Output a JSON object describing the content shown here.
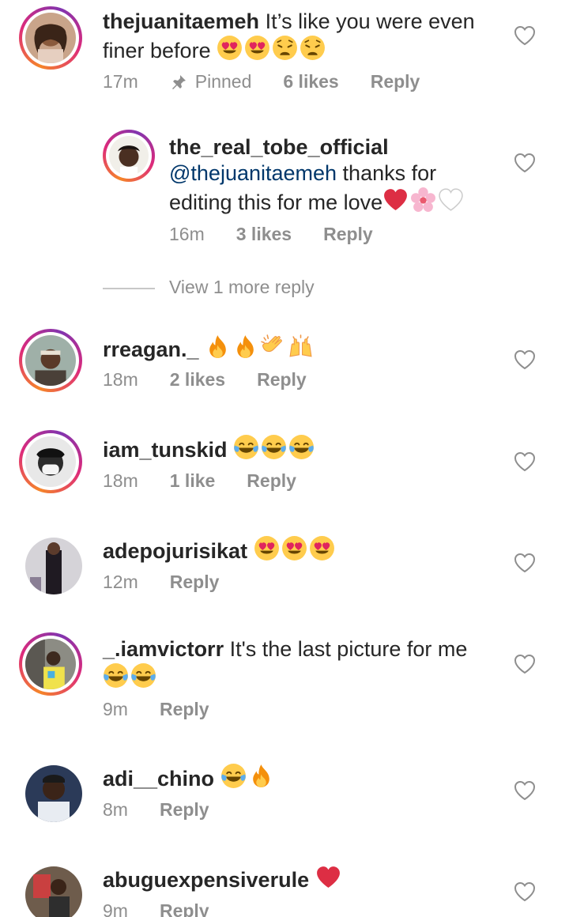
{
  "comments": [
    {
      "username": "thejuanitaemeh",
      "text": "It’s like you were even",
      "text2": "finer before",
      "emojis": [
        "heart-eyes",
        "heart-eyes",
        "weary",
        "weary"
      ],
      "time": "17m",
      "pinned": "Pinned",
      "likes": "6 likes",
      "reply": "Reply"
    },
    {
      "username": "the_real_tobe_official",
      "mention": "@thejuanitaemeh",
      "text": " thanks for",
      "text2": "editing this for me love",
      "emojis": [
        "red-heart",
        "cherry-blossom",
        "white-heart"
      ],
      "time": "16m",
      "likes": "3 likes",
      "reply": "Reply"
    },
    {
      "username": "rreagan._",
      "emojis": [
        "fire",
        "fire",
        "clapping",
        "raising-hands"
      ],
      "time": "18m",
      "likes": "2 likes",
      "reply": "Reply"
    },
    {
      "username": "iam_tunskid",
      "emojis": [
        "joy",
        "joy",
        "joy"
      ],
      "time": "18m",
      "likes": "1 like",
      "reply": "Reply"
    },
    {
      "username": "adepojurisikat",
      "emojis": [
        "heart-eyes",
        "heart-eyes",
        "heart-eyes"
      ],
      "time": "12m",
      "reply": "Reply"
    },
    {
      "username": "_.iamvictorr",
      "text": "It's the last picture for me",
      "emojis": [
        "joy",
        "joy"
      ],
      "time": "9m",
      "reply": "Reply"
    },
    {
      "username": "adi__chino",
      "emojis": [
        "joy",
        "fire"
      ],
      "time": "8m",
      "reply": "Reply"
    },
    {
      "username": "abuguexpensiverule",
      "emojis": [
        "red-heart"
      ],
      "time": "9m",
      "reply": "Reply"
    }
  ],
  "view_more_replies": "View 1 more reply",
  "colors": {
    "mention": "#00376b",
    "secondary": "#8e8e8e",
    "ring_start": "#f58529",
    "ring_end": "#dd2a7b"
  }
}
